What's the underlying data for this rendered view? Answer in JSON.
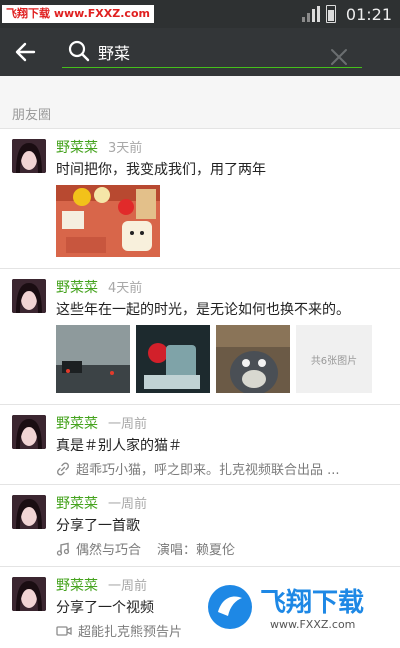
{
  "status_bar": {
    "watermark": "飞翔下载 www.FXXZ.com",
    "time": "01:21"
  },
  "toolbar": {
    "search_query": "野菜"
  },
  "section": {
    "title": "朋友圈"
  },
  "posts": [
    {
      "user_highlight": "野菜",
      "user_rest": "菜",
      "time": "3天前",
      "text": "时间把你，我变成我们，用了两年"
    },
    {
      "user_highlight": "野菜",
      "user_rest": "菜",
      "time": "4天前",
      "text": "这些年在一起的时光，是无论如何也换不来的。",
      "more_photos": "共6张图片"
    },
    {
      "user_highlight": "野菜",
      "user_rest": "菜",
      "time": "一周前",
      "text": "真是＃别人家的猫＃",
      "link": "超乖巧小猫，呼之即来。扎克视频联合出品 ..."
    },
    {
      "user_highlight": "野菜",
      "user_rest": "菜",
      "time": "一周前",
      "text": "分享了一首歌",
      "music_title": "偶然与巧合",
      "music_artist": "演唱：赖夏伦"
    },
    {
      "user_highlight": "野菜",
      "user_rest": "菜",
      "time": "一周前",
      "text": "分享了一个视频",
      "video_title": "超能扎克熊预告片"
    }
  ],
  "watermark_bottom": {
    "brand": "飞翔下载",
    "url": "www.FXXZ.com"
  },
  "icons": {
    "back": "arrow-left-icon",
    "search": "search-icon",
    "clear": "close-icon",
    "link": "link-icon",
    "music": "music-note-icon",
    "video": "video-camera-icon"
  },
  "colors": {
    "status_bar": "#2e3132",
    "toolbar": "#333638",
    "accent_green": "#45a31e",
    "search_underline": "#45c01a",
    "watermark_red": "#e02020",
    "watermark_blue": "#1e88e5"
  }
}
